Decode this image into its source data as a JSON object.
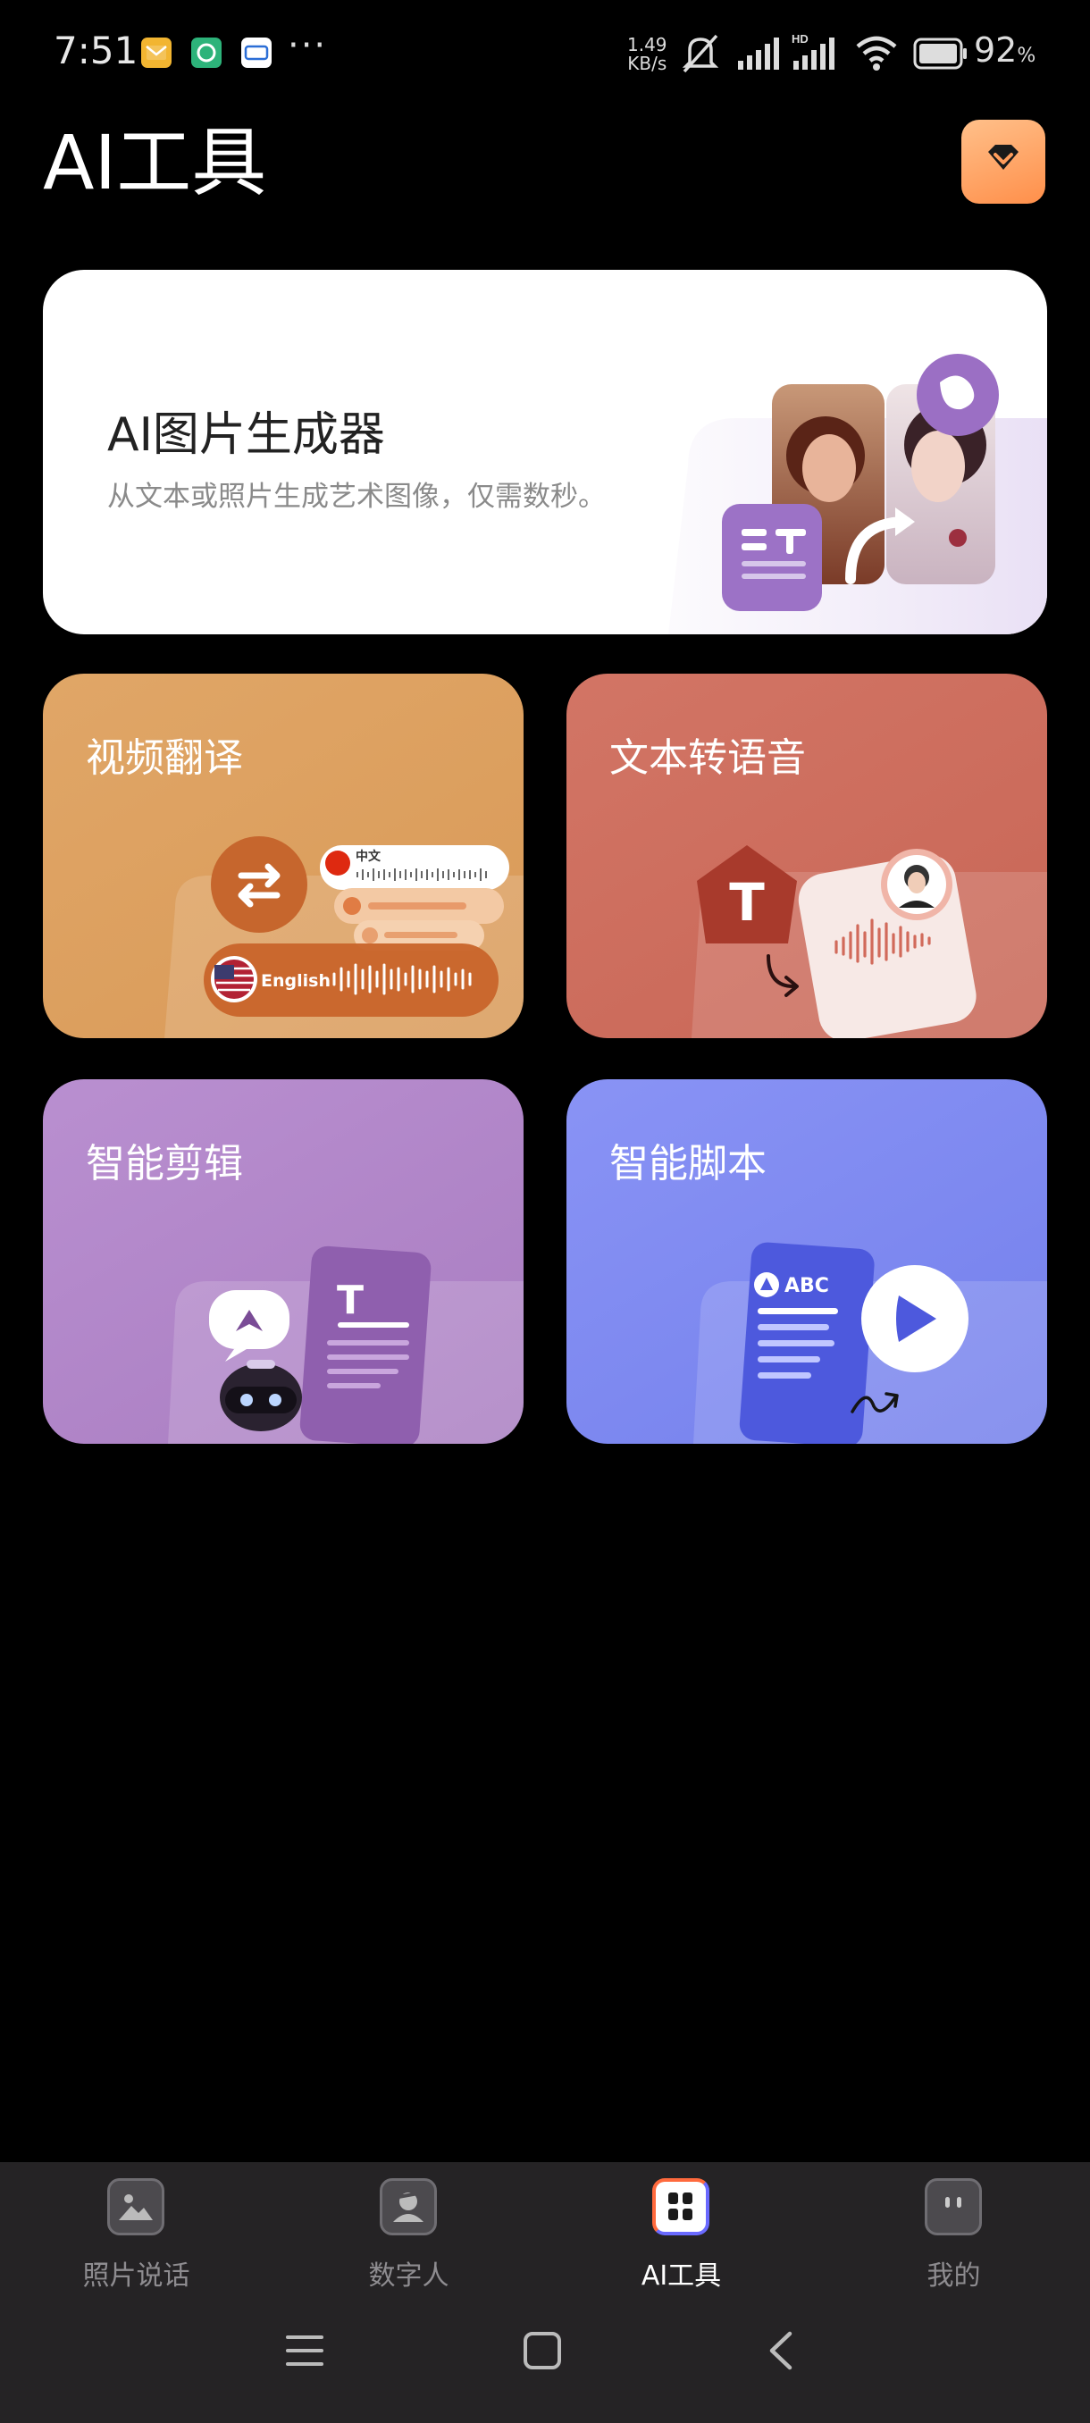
{
  "status_bar": {
    "time": "7:51",
    "more": "···",
    "speed_value": "1.49",
    "speed_unit": "KB/s",
    "battery_percent": "92",
    "battery_unit": "%",
    "icons": [
      "mail-icon",
      "app-icon",
      "cloud-icon",
      "mute-icon",
      "signal-icon",
      "hd-signal-icon",
      "wifi-icon",
      "battery-icon"
    ]
  },
  "header": {
    "title": "AI工具",
    "vip_icon": "diamond-icon"
  },
  "cards": {
    "image_generator": {
      "title": "AI图片生成器",
      "description": "从文本或照片生成艺术图像，仅需数秒。"
    },
    "video_translate": {
      "title": "视频翻译",
      "lang_from": "中文",
      "lang_to": "English"
    },
    "text_to_speech": {
      "title": "文本转语音",
      "glyph": "T"
    },
    "smart_edit": {
      "title": "智能剪辑",
      "glyph": "T"
    },
    "smart_script": {
      "title": "智能脚本",
      "doc_label": "ABC"
    }
  },
  "bottom_nav": {
    "active": "AI工具",
    "items": [
      {
        "label": "照片说话",
        "icon": "photo-icon"
      },
      {
        "label": "数字人",
        "icon": "avatar-icon"
      },
      {
        "label": "AI工具",
        "icon": "grid-icon"
      },
      {
        "label": "我的",
        "icon": "face-icon"
      }
    ]
  },
  "colors": {
    "video_card": "#D99A58",
    "tts_card": "#C86656",
    "edit_card": "#A97DC1",
    "script_card": "#7480EC",
    "vip_accent": "#FF9D5C"
  }
}
